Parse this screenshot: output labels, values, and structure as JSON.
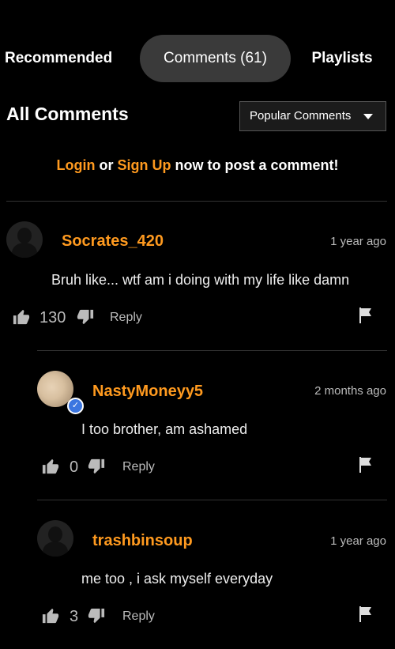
{
  "tabs": [
    {
      "label": "Recommended",
      "active": false
    },
    {
      "label": "Comments (61)",
      "active": true
    },
    {
      "label": "Playlists",
      "active": false
    }
  ],
  "section": {
    "title": "All Comments"
  },
  "sort": {
    "selected": "Popular Comments"
  },
  "login_prompt": {
    "login": "Login",
    "or": "or",
    "signup": "Sign Up",
    "rest": "now to post a comment!"
  },
  "comments": [
    {
      "username": "Socrates_420",
      "time": "1 year ago",
      "text": "Bruh like... wtf am i doing with my life like damn",
      "likes": "130",
      "reply": "Reply"
    },
    {
      "username": "NastyMoneyy5",
      "time": "2 months ago",
      "text": "I too brother, am ashamed",
      "likes": "0",
      "reply": "Reply",
      "verified": true
    },
    {
      "username": "trashbinsoup",
      "time": "1 year ago",
      "text": "me too , i ask myself everyday",
      "likes": "3",
      "reply": "Reply"
    }
  ],
  "colors": {
    "accent": "#ff9a1f",
    "background": "#000000",
    "active_tab": "#3a3a3a",
    "verified": "#3c76e0"
  }
}
